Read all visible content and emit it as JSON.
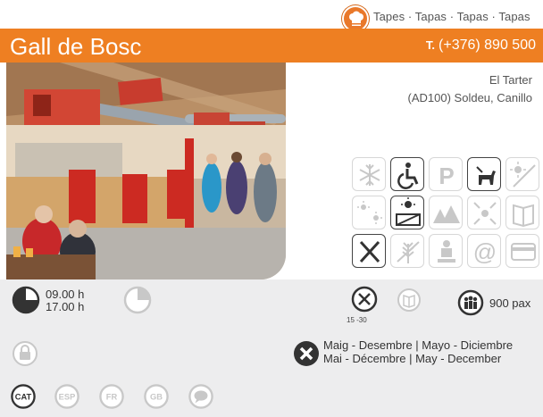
{
  "category": {
    "icon": "chef-hat-icon",
    "text": "Tapes · Tapas · Tapas · Tapas"
  },
  "header": {
    "name": "Gall de Bosc",
    "phone_label": "T.",
    "phone": "(+376) 890 500",
    "accent": "#ee7f22"
  },
  "address": {
    "line1": "El Tarter",
    "line2": "(AD100) Soldeu, Canillo"
  },
  "amenities": [
    {
      "icon": "air-conditioning-icon",
      "active": false
    },
    {
      "icon": "wheelchair-icon",
      "active": true
    },
    {
      "icon": "parking-icon",
      "active": false
    },
    {
      "icon": "pets-allowed-icon",
      "active": true
    },
    {
      "icon": "terrace-off-icon",
      "active": false
    },
    {
      "icon": "heating-icon",
      "active": false
    },
    {
      "icon": "terrace-icon",
      "active": true
    },
    {
      "icon": "mountain-view-icon",
      "active": false
    },
    {
      "icon": "air-renewal-icon",
      "active": false
    },
    {
      "icon": "menu-icon",
      "active": false
    },
    {
      "icon": "restaurant-icon",
      "active": true
    },
    {
      "icon": "gluten-free-icon",
      "active": false
    },
    {
      "icon": "cooking-class-icon",
      "active": false
    },
    {
      "icon": "internet-icon",
      "active": false
    },
    {
      "icon": "credit-card-icon",
      "active": false
    }
  ],
  "hours": {
    "open": "09.00 h",
    "close": "17.00 h"
  },
  "meal": {
    "sub": "15 -30"
  },
  "capacity": {
    "text": "900 pax"
  },
  "closing": {
    "line1": "Maig - Desembre | Mayo - Diciembre",
    "line2": "Mai - Décembre | May - December"
  },
  "languages": [
    "CAT",
    "ESP",
    "FR",
    "GB"
  ],
  "colors": {
    "orange": "#ee7f22",
    "dark_icon": "#333333",
    "light_icon": "#c8c8c8",
    "panel": "#ededee"
  }
}
